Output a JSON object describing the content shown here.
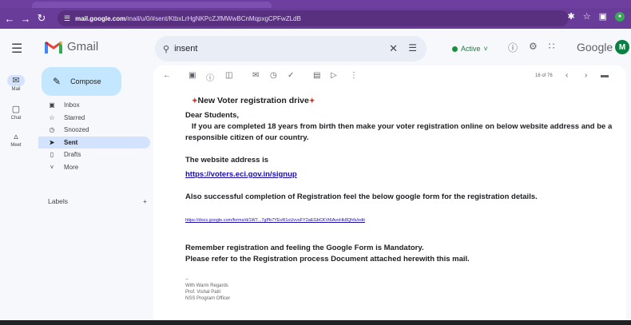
{
  "browser": {
    "url_host": "mail.google.com",
    "url_path": "/mail/u/0/#sent/KtbxLrHgNKPcZJfMWwBCnMqpxgCPFwZLdB",
    "colors": {
      "chrome": "#6a3c99",
      "omnibox": "#58307f"
    }
  },
  "header": {
    "app_name": "Gmail",
    "search_value": "insent",
    "status": "Active",
    "brand_word": "Google",
    "avatar_letter": "M"
  },
  "rail": {
    "items": [
      {
        "label": "Mail",
        "icon": "mail-icon"
      },
      {
        "label": "Chat",
        "icon": "chat-icon"
      },
      {
        "label": "Meet",
        "icon": "meet-icon"
      }
    ]
  },
  "sidebar": {
    "compose_label": "Compose",
    "items": [
      {
        "label": "Inbox",
        "icon": "inbox-icon"
      },
      {
        "label": "Starred",
        "icon": "star-icon"
      },
      {
        "label": "Snoozed",
        "icon": "clock-icon"
      },
      {
        "label": "Sent",
        "icon": "send-icon",
        "active": true
      },
      {
        "label": "Drafts",
        "icon": "draft-icon"
      },
      {
        "label": "More",
        "icon": "chevron-down-icon"
      }
    ],
    "labels_heading": "Labels"
  },
  "toolbar": {
    "pager_text": "16 of 76"
  },
  "email": {
    "title": "New Voter registration drive",
    "greeting": "Dear Students,",
    "para1": "   If you are completed 18 years from birth then make your voter registration online on below website address and be a responsible citizen of our country.",
    "website_intro": "The website address is",
    "website_link": "https://voters.eci.gov.in/signup",
    "para2": "Also successful completion of Registration feel the below google form for the registration details.",
    "form_link": "https://docs.google.com/forms/d/1W7...7gPb7YEvR1oUvvsFY2aEGbCKVt6AvoHk8Qhfs/edit",
    "reminder": "Remember registration and feeling the Google Form is Mandatory.",
    "refer": "Please refer to the Registration process Document attached herewith this mail.",
    "sig_dash": "--",
    "sig_line1": "With Warm Regards",
    "sig_line2": "Prof. Vishal Patil",
    "sig_line3": "NSS Program  Officer"
  }
}
